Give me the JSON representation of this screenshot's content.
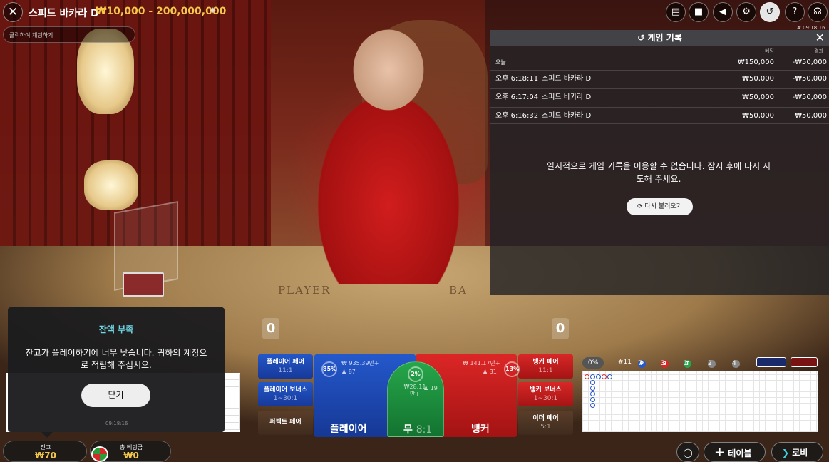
{
  "header": {
    "close_icon": "close-icon",
    "title": "스피드 바카라 D",
    "limits": "₩10,000 - 200,000,000",
    "pin_icon": "pin-icon",
    "chat_placeholder": "클릭하여 채팅하기",
    "clock": "# 09:18:16",
    "buttons": [
      "chat-icon",
      "camera-icon",
      "volume-icon",
      "gear-icon",
      "history-icon",
      "help-icon",
      "headset-icon"
    ]
  },
  "history": {
    "title": "게임 기록",
    "col_bet": "베팅",
    "col_result": "결과",
    "today_label": "오늘",
    "today_bet": "₩150,000",
    "today_result": "-₩50,000",
    "rows": [
      {
        "time": "오후 6:18:11",
        "game": "스피드 바카라 D",
        "bet": "₩50,000",
        "result": "-₩50,000"
      },
      {
        "time": "오후 6:17:04",
        "game": "스피드 바카라 D",
        "bet": "₩50,000",
        "result": "-₩50,000"
      },
      {
        "time": "오후 6:16:32",
        "game": "스피드 바카라 D",
        "bet": "₩50,000",
        "result": "₩50,000"
      }
    ],
    "message": "일시적으로 게임 기록을 이용할 수 없습니다. 잠시 후에 다시 시도해 주세요.",
    "reload_label": "다시 불러오기"
  },
  "table_text": {
    "player": "PLAYER",
    "banker": "BA"
  },
  "scores": {
    "player": "0",
    "banker": "0"
  },
  "popup": {
    "title": "잔액 부족",
    "message": "잔고가 플레이하기에 너무 낮습니다. 귀하의 계정으로 적립해 주십시오.",
    "button": "닫기",
    "time": "09:18:16"
  },
  "bets": {
    "player_pair": {
      "label": "플레이어 페어",
      "odds": "11:1"
    },
    "player_bonus": {
      "label": "플레이어 보너스",
      "odds": "1~30:1"
    },
    "perfect_pair": {
      "label": "퍼펙트 페어",
      "odds": ""
    },
    "banker_pair": {
      "label": "뱅커 페어",
      "odds": "11:1"
    },
    "banker_bonus": {
      "label": "뱅커 보너스",
      "odds": "1~30:1"
    },
    "either_pair": {
      "label": "이더 페어",
      "odds": "5:1"
    },
    "player": {
      "label": "플레이어",
      "pct": "85%",
      "amount": "₩ 935.39만+",
      "count": "87"
    },
    "tie": {
      "label": "무",
      "odds": "8:1",
      "pct": "2%",
      "amount": "₩28.11만+",
      "count": "19"
    },
    "banker": {
      "label": "뱅커",
      "pct": "13%",
      "amount": "₩ 141.17만+",
      "count": "31"
    }
  },
  "stats": {
    "progress": "0%",
    "round": "#11",
    "p_count": "7",
    "b_count": "3",
    "t_count": "1",
    "pp_count": "2",
    "bp_count": "4",
    "p_letter": "P",
    "b_letter": "B",
    "t_letter": "T",
    "colors": {
      "player": "#2458cb",
      "banker": "#dc2626",
      "tie": "#26a64a"
    }
  },
  "bottom": {
    "balance_label": "잔고",
    "balance_value": "₩70",
    "total_bet_label": "총 베팅금",
    "total_bet_value": "₩0",
    "table_label": "테이블",
    "lobby_label": "로비"
  }
}
